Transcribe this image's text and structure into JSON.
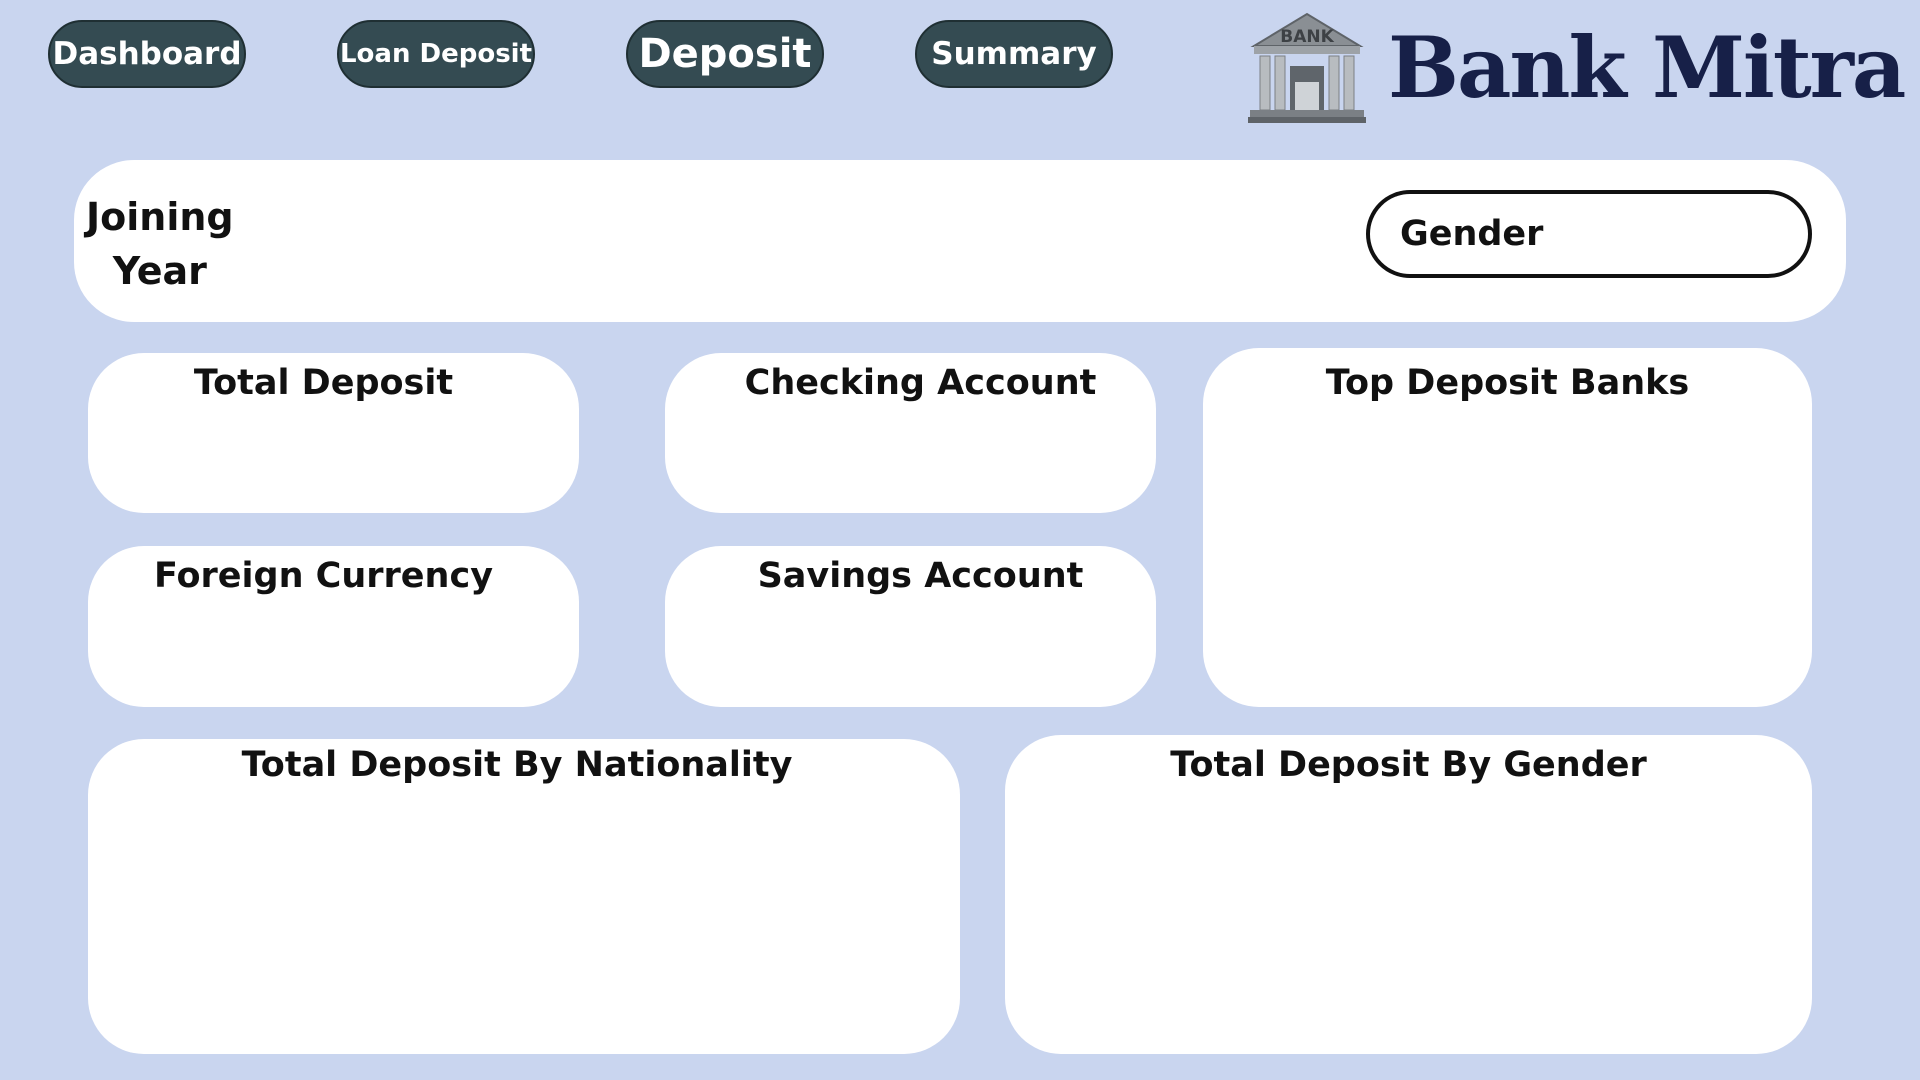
{
  "nav": {
    "dashboard": "Dashboard",
    "loan_deposit": "Loan Deposit",
    "deposit": "Deposit",
    "summary": "Summary"
  },
  "brand": {
    "title": "Bank Mitra",
    "logo_text": "BANK",
    "logo_icon": "bank-building-icon"
  },
  "filters": {
    "joining_year_line1": "Joining",
    "joining_year_line2": "Year",
    "gender_placeholder": "Gender"
  },
  "cards": {
    "total_deposit": "Total Deposit",
    "checking_account": "Checking Account",
    "top_deposit_banks": "Top Deposit Banks",
    "foreign_currency": "Foreign Currency",
    "savings_account": "Savings Account",
    "by_nationality": "Total Deposit By Nationality",
    "by_gender": "Total Deposit By Gender"
  },
  "colors": {
    "background": "#c9d5ef",
    "nav_button": "#344b52",
    "brand": "#172048",
    "card": "#ffffff"
  }
}
